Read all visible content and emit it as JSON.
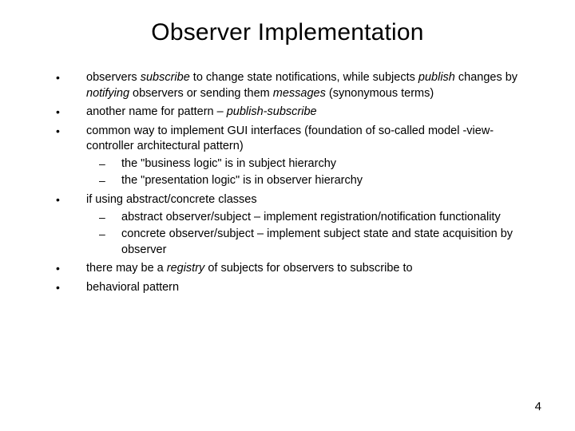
{
  "title": "Observer Implementation",
  "bullets": {
    "b1_pre": "observers ",
    "b1_sub": "subscribe",
    "b1_mid1": " to change state notifications, while subjects ",
    "b1_pub": "publish",
    "b1_mid2": " changes by ",
    "b1_not": "notifying",
    "b1_mid3": " observers or sending them ",
    "b1_msg": "messages",
    "b1_end": " (synonymous terms)",
    "b2_pre": "another name for pattern – ",
    "b2_ps": "publish-subscribe",
    "b3": "common way to implement GUI interfaces (foundation of so-called model -view-controller architectural pattern)",
    "b3s1": "the \"business logic\" is in subject hierarchy",
    "b3s2": "the \"presentation logic\" is in observer hierarchy",
    "b4": "if using abstract/concrete classes",
    "b4s1": "abstract observer/subject – implement registration/notification functionality",
    "b4s2": "concrete observer/subject – implement subject state  and state acquisition by observer",
    "b5_pre": "there may be a ",
    "b5_reg": "registry",
    "b5_end": " of subjects for observers to subscribe to",
    "b6": "behavioral pattern"
  },
  "page_number": "4"
}
